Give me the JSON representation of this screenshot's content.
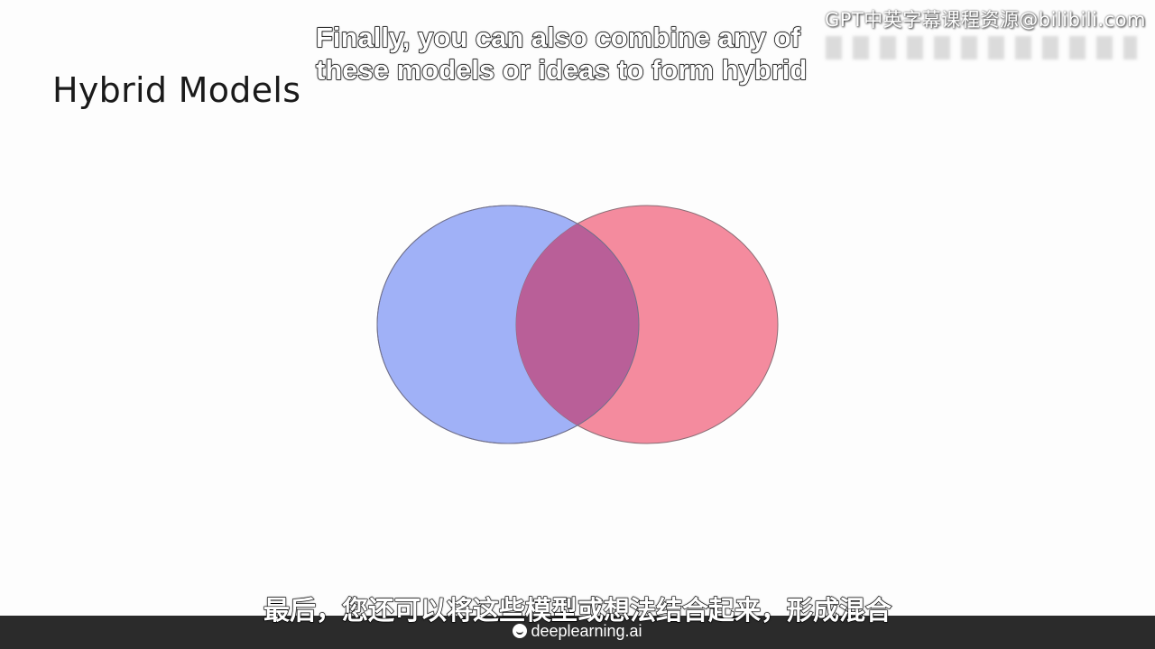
{
  "slide": {
    "title": "Hybrid Models"
  },
  "subtitles": {
    "en_line1": "Finally, you can also combine any of",
    "en_line2": "these models or ideas to form hybrid",
    "zh": "最后，您还可以将这些模型或想法结合起来，形成混合"
  },
  "watermark": {
    "text": "GPT中英字幕课程资源@bilibili.com"
  },
  "footer": {
    "brand": "deeplearning.ai",
    "brand_icon": "deeplearning-logo-icon",
    "bar_color": "#2b2b2b"
  },
  "venn": {
    "left_color": "#a0b1f7",
    "right_color": "#f48b9e",
    "overlap_color": "#b95f98"
  }
}
